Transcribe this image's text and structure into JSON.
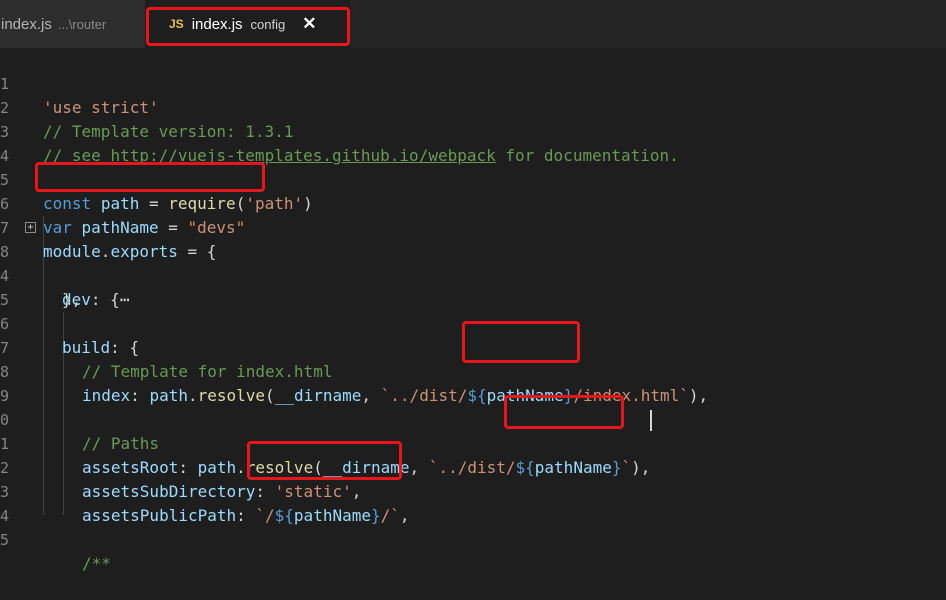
{
  "tabs": [
    {
      "name": "index.js",
      "description": "...\\router"
    },
    {
      "icon_label": "JS",
      "name": "index.js",
      "description": "config",
      "close_glyph": "✕"
    }
  ],
  "gutter": {
    "line_numbers": [
      "1",
      "2",
      "3",
      "4",
      "5",
      "6",
      "7",
      "8",
      "4",
      "5",
      "6",
      "7",
      "8",
      "9",
      "0",
      "1",
      "2",
      "3",
      "4",
      "5"
    ],
    "fold_glyph": "+"
  },
  "code": {
    "l1": {
      "a": "'use strict'"
    },
    "l2": {
      "a": "// Template version: 1.3.1"
    },
    "l3": {
      "a": "// see ",
      "link": "http://vuejs-templates.github.io/webpack",
      "b": " for documentation."
    },
    "l5": {
      "a": "const",
      "b": " ",
      "c": "path",
      "d": " = ",
      "e": "require",
      "f": "(",
      "g": "'path'",
      "h": ")"
    },
    "l6": {
      "a": "var",
      "b": " ",
      "c": "pathName",
      "d": " = ",
      "e": "\"devs\""
    },
    "l7": {
      "a": "module",
      "b": ".",
      "c": "exports",
      "d": " = {"
    },
    "l8": {
      "a": "dev",
      "b": ": {",
      "c": "⋯"
    },
    "l9": {
      "a": "},"
    },
    "l11": {
      "a": "build",
      "b": ": {"
    },
    "l12": {
      "a": "// Template for index.html"
    },
    "l13": {
      "a": "index",
      "b": ": ",
      "c": "path",
      "d": ".",
      "e": "resolve",
      "f": "(",
      "g": "__dirname",
      "h": ", ",
      "i": "`../dist/",
      "j": "${",
      "k": "pathName",
      "l": "}",
      "m": "/index.html`",
      "n": "),"
    },
    "l15": {
      "a": "// Paths"
    },
    "l16": {
      "a": "assetsRoot",
      "b": ": ",
      "c": "path",
      "d": ".",
      "e": "resolve",
      "f": "(",
      "g": "__dirname",
      "h": ", ",
      "i": "`../dist/",
      "j": "${",
      "k": "pathName",
      "l": "}",
      "m": "`",
      "n": "),"
    },
    "l17": {
      "a": "assetsSubDirectory",
      "b": ": ",
      "c": "'static'",
      "d": ","
    },
    "l18": {
      "a": "assetsPublicPath",
      "b": ": ",
      "c": "`/",
      "d": "${",
      "e": "pathName",
      "f": "}",
      "g": "/`",
      "h": ","
    },
    "l20": {
      "a": "/**"
    }
  },
  "colors": {
    "highlight_border": "#e8161a",
    "keyword": "#569cd6",
    "variable": "#9cdcfe",
    "function": "#dcdcaa",
    "string": "#ce9178",
    "comment": "#6a9955"
  }
}
